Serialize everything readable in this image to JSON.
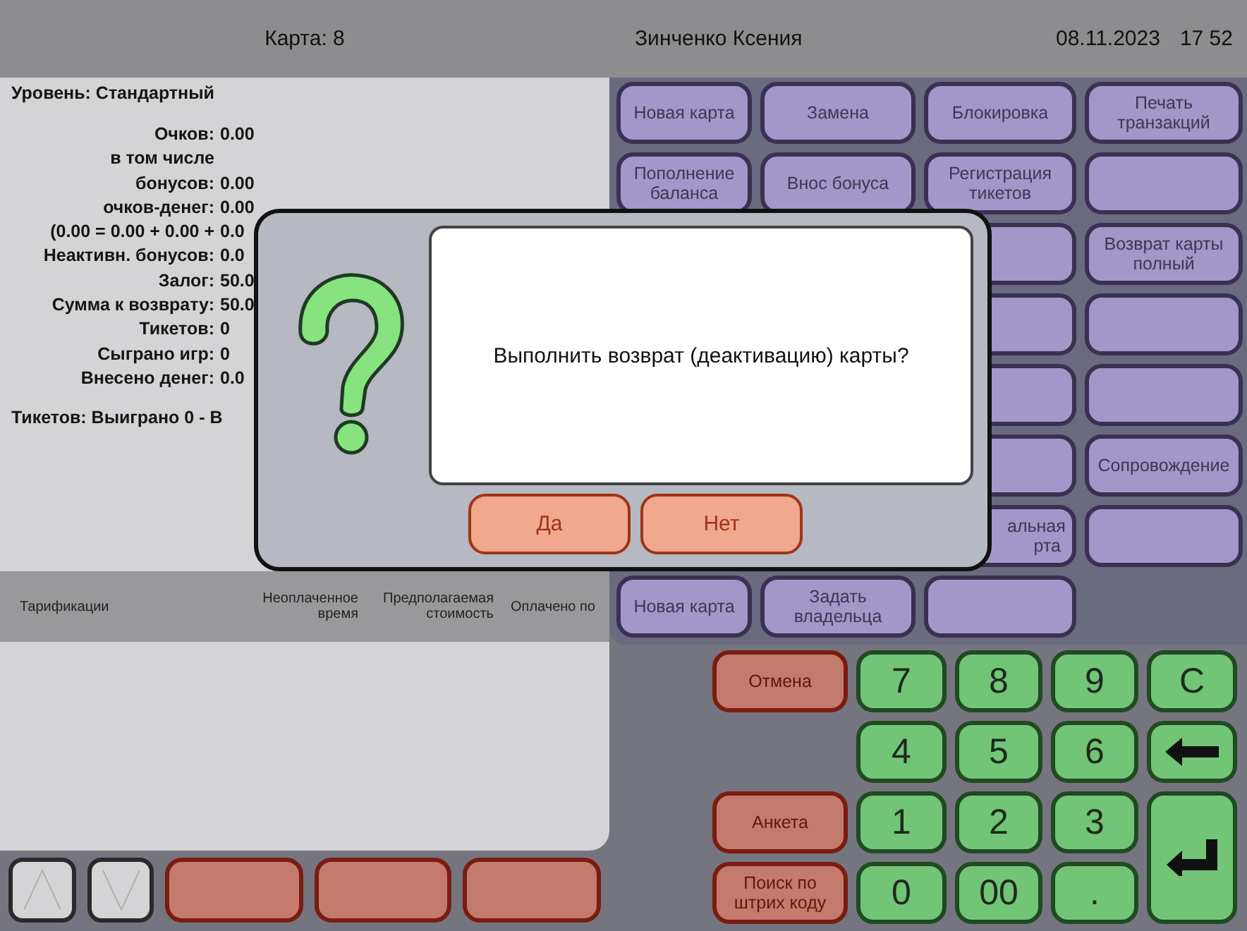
{
  "card_header": {
    "title": "Карта: 8"
  },
  "info": {
    "level": "Уровень: Стандартный",
    "lines": [
      {
        "label": "Очков:",
        "value": "0.00"
      },
      {
        "label": "в том числе"
      },
      {
        "label": "бонусов:",
        "value": "0.00"
      },
      {
        "label": "очков-денег:",
        "value": "0.00"
      },
      {
        "label": "(0.00 = 0.00 + 0.00 +",
        "value": "0.0"
      },
      {
        "label": "Неактивн. бонусов:",
        "value": "0.0"
      },
      {
        "label": "Залог:",
        "value": "50.0"
      },
      {
        "label": "Сумма к возврату:",
        "value": "50.0"
      },
      {
        "label": "Тикетов:",
        "value": "0"
      },
      {
        "label": "Сыграно игр:",
        "value": "0"
      },
      {
        "label": "Внесено денег:",
        "value": "0.0"
      }
    ],
    "tickets": "Тикетов: Выиграно 0 - В"
  },
  "tariffs": {
    "columns": [
      "Тарификации",
      "Неоплаченное время",
      "Предполагаемая стоимость",
      "Оплачено по"
    ]
  },
  "bottom_buttons": [
    {
      "kind": "up"
    },
    {
      "kind": "down"
    },
    {
      "kind": "action"
    },
    {
      "kind": "action"
    },
    {
      "kind": "action"
    }
  ],
  "header": {
    "operator": "Зинченко Ксения",
    "date": "08.11.2023",
    "time": "17 52"
  },
  "button_rows": [
    [
      {
        "label": "Новая карта"
      },
      {
        "label": "Замена"
      },
      {
        "label": "Блокировка"
      },
      {
        "label": "Печать транзакций"
      }
    ],
    [
      {
        "label": "Пополнение баланса"
      },
      {
        "label": "Внос бонуса"
      },
      {
        "label": "Регистрация тикетов"
      },
      {}
    ],
    [
      {},
      {
        "label": "Возврат карты полный"
      }
    ],
    [
      {},
      {}
    ],
    [
      {},
      {}
    ],
    [
      {},
      {
        "label": "Сопровождение"
      }
    ],
    [
      {
        "label": "альная рта"
      },
      {}
    ],
    [
      {
        "label": "Новая карта"
      },
      {
        "label": "Задать владельца"
      },
      {}
    ]
  ],
  "side_buttons": [
    {
      "label": "Отмена"
    },
    {
      "label": "Анкета"
    },
    {
      "label": "Поиск по штрих коду"
    }
  ],
  "keypad": [
    {
      "kind": "digit",
      "label": "7"
    },
    {
      "kind": "digit",
      "label": "8"
    },
    {
      "kind": "digit",
      "label": "9"
    },
    {
      "kind": "digit",
      "label": "C"
    },
    {
      "kind": "digit",
      "label": "4"
    },
    {
      "kind": "digit",
      "label": "5"
    },
    {
      "kind": "digit",
      "label": "6"
    },
    {
      "kind": "backspace"
    },
    {
      "kind": "digit",
      "label": "1"
    },
    {
      "kind": "digit",
      "label": "2"
    },
    {
      "kind": "digit",
      "label": "3"
    },
    {
      "kind": "enter"
    },
    {
      "kind": "digit",
      "label": "0"
    },
    {
      "kind": "digit",
      "label": "00"
    },
    {
      "kind": "digit",
      "label": "."
    }
  ],
  "dialog": {
    "message": "Выполнить возврат (деактивацию) карты?",
    "buttons": [
      "Да",
      "Нет"
    ]
  }
}
